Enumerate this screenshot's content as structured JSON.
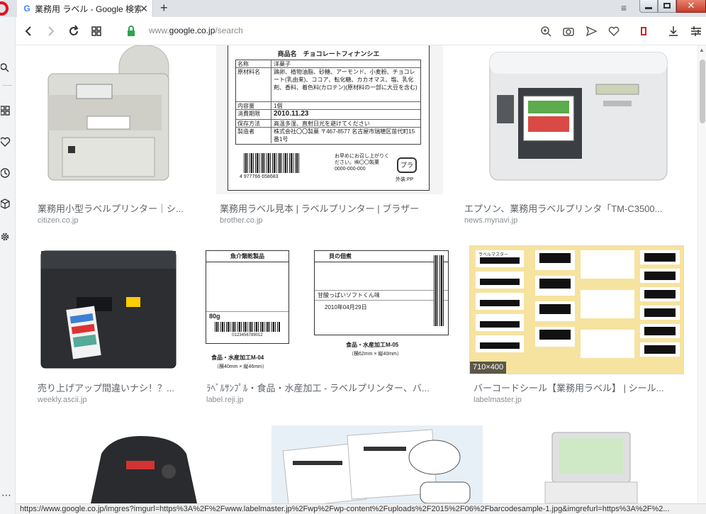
{
  "tab": {
    "title": "業務用 ラベル - Google 検索",
    "close": "✕",
    "new_tab": "+"
  },
  "address": {
    "prefix": "www.",
    "host": "google.co.jp",
    "path": "/search"
  },
  "results": [
    {
      "title": "業務用小型ラベルプリンター｜シ...",
      "source": "citizen.co.jp"
    },
    {
      "title": "業務用ラベル見本 | ラベルプリンター | ブラザー",
      "source": "brother.co.jp"
    },
    {
      "title": "エプソン、業務用ラベルプリンタ「TM-C3500...",
      "source": "news.mynavi.jp"
    },
    {
      "title": "売り上げアップ間違いナシ！？...",
      "source": "weekly.ascii.jp"
    },
    {
      "title": "ﾗﾍﾞﾙｻﾝﾌﾟﾙ・食品・水産加工 - ラベルプリンター、バ...",
      "source": "label.reji.jp"
    },
    {
      "title": "バーコードシール【業務用ラベル】 | シール...",
      "source": "labelmaster.jp",
      "badge": "710×400"
    }
  ],
  "label_sample": {
    "heading": "商品名　チョコレートフィナンシエ",
    "rows": [
      [
        "名称",
        "洋菓子"
      ],
      [
        "原材料名",
        "鶏卵、植物油脂、砂糖、アーモンド、小麦粉、チョコレート(乳由来)、ココア、転化糖、カカオマス、塩、乳化剤、香料、着色料(カロテン)(原材料の一部に大豆を含む)"
      ],
      [
        "内容量",
        "1個"
      ],
      [
        "消費期限",
        "2010.11.23"
      ],
      [
        "保存方法",
        "高温多湿、直射日光を避けてください"
      ],
      [
        "製造者",
        "株式会社〇〇製菓 〒467-8577 名古屋市瑞穂区苗代町15番1号"
      ]
    ],
    "barcode_digits": "4 977766 658683",
    "note": "お早めにお召し上がりください。㈱〇〇製菓 0000-000-000",
    "recycle": "外装:PP"
  },
  "food_labels": {
    "left_caption": "食品・水産加工M-04",
    "left_size": "（横40mm × 縦46mm）",
    "right_caption": "食品・水産加工M-05",
    "right_size": "（横62mm × 縦40mm）",
    "left_title": "魚介類乾製品",
    "right_title": "貝の佃煮",
    "right_product": "甘酸っぱいソフトくん味",
    "date": "2010年04月29日",
    "weight": "80g",
    "left_barcode_digits": "0123456789012"
  },
  "barcode_sheet": {
    "brand": "ラベルマスター"
  },
  "status_url": "https://www.google.co.jp/imgres?imgurl=https%3A%2F%2Fwww.labelmaster.jp%2Fwp%2Fwp-content%2Fuploads%2F2015%2F06%2Fbarcodesample-1.jpg&imgrefurl=https%3A%2F%2..."
}
